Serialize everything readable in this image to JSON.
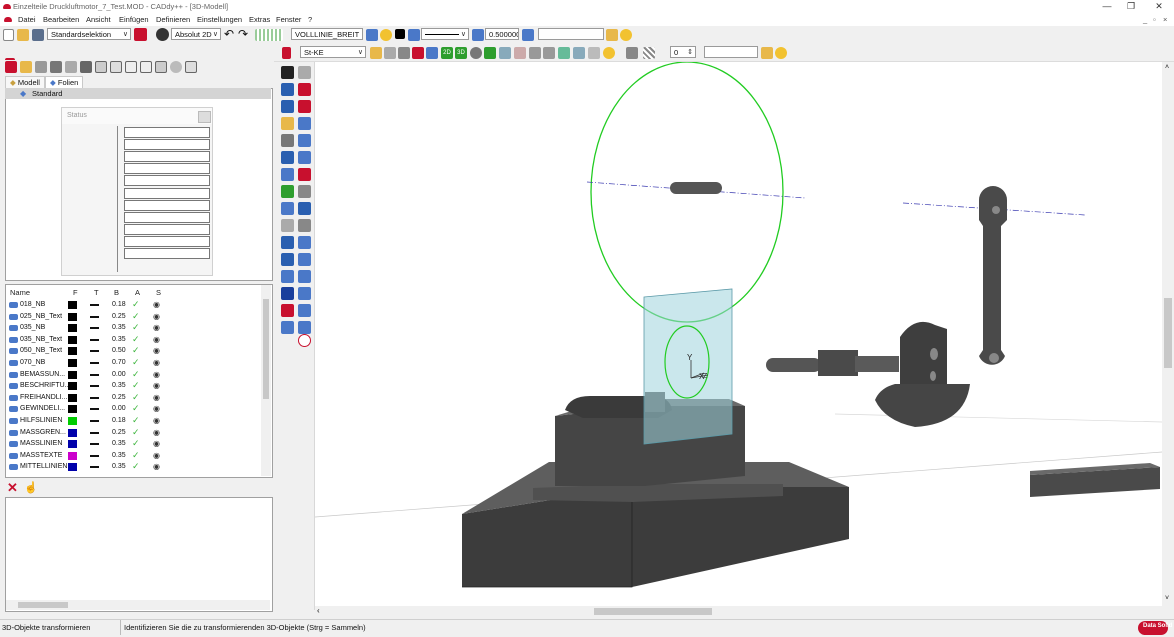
{
  "window": {
    "title": "Einzelteile Druckluftmotor_7_Test.MOD  -  CADdy++ - [3D-Modell]",
    "controls": [
      "—",
      "❐",
      "✕"
    ],
    "inner_controls": [
      "_",
      "▫",
      "×"
    ]
  },
  "menu": [
    "Datei",
    "Bearbeiten",
    "Ansicht",
    "Einfügen",
    "Definieren",
    "Einstellungen",
    "Extras",
    "Fenster",
    "?"
  ],
  "toolbar1": {
    "selection_mode": "Standardselektion",
    "coordinate_mode": "Absolut 2D",
    "line_type": "VOLLLINIE_BREIT",
    "line_width": "0.500000",
    "extra_field": ""
  },
  "toolbar2": {
    "material": "St-KE",
    "level_value": "0",
    "extra_field": ""
  },
  "left_panel": {
    "tabs": [
      "Modell",
      "Folien"
    ],
    "active_tab": "Folien",
    "tree_root": "Standard",
    "status_title": "Status",
    "layer_headers": [
      "Name",
      "F",
      "T",
      "B",
      "A",
      "S"
    ],
    "layers": [
      {
        "name": "018_NB",
        "color": "#000000",
        "width": "0.18"
      },
      {
        "name": "025_NB_Text",
        "color": "#000000",
        "width": "0.25"
      },
      {
        "name": "035_NB",
        "color": "#000000",
        "width": "0.35"
      },
      {
        "name": "035_NB_Text",
        "color": "#000000",
        "width": "0.35"
      },
      {
        "name": "050_NB_Text",
        "color": "#000000",
        "width": "0.50"
      },
      {
        "name": "070_NB",
        "color": "#000000",
        "width": "0.70"
      },
      {
        "name": "BEMASSUN...",
        "color": "#000000",
        "width": "0.00"
      },
      {
        "name": "BESCHRIFTU...",
        "color": "#000000",
        "width": "0.35"
      },
      {
        "name": "FREIHANDLI...",
        "color": "#000000",
        "width": "0.25"
      },
      {
        "name": "GEWINDELI...",
        "color": "#000000",
        "width": "0.00"
      },
      {
        "name": "HILFSLINIEN",
        "color": "#00cc00",
        "width": "0.18"
      },
      {
        "name": "MASSGREN...",
        "color": "#0000aa",
        "width": "0.25"
      },
      {
        "name": "MASSLINIEN",
        "color": "#0000aa",
        "width": "0.35"
      },
      {
        "name": "MASSTEXTE",
        "color": "#cc00cc",
        "width": "0.35"
      },
      {
        "name": "MITTELLINIEN",
        "color": "#0000aa",
        "width": "0.35"
      }
    ]
  },
  "viewport": {
    "axis_y": "Y",
    "axis_x": "X",
    "axis_z": "Z"
  },
  "statusbar": {
    "mode": "3D-Objekte transformieren",
    "prompt": "Identifizieren Sie die zu transformierenden 3D-Objekte (Strg = Sammeln)"
  },
  "brand": "Data Solid",
  "colors": {
    "accent": "#c8102e",
    "selection_circle": "#22cc22",
    "transparent_plane": "#9fd3dc"
  }
}
